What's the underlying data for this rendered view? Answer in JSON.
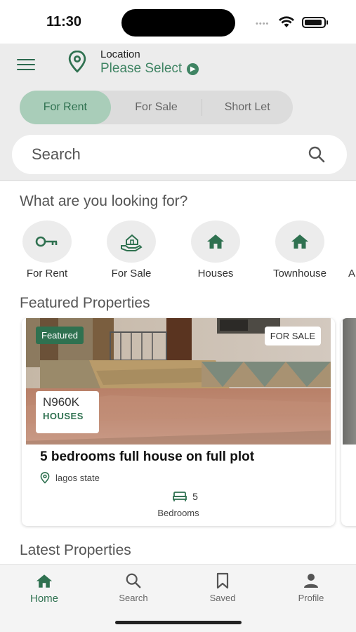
{
  "status_bar": {
    "time": "11:30"
  },
  "header": {
    "location_label": "Location",
    "location_value": "Please Select"
  },
  "segments": [
    {
      "label": "For Rent",
      "active": true
    },
    {
      "label": "For Sale",
      "active": false
    },
    {
      "label": "Short Let",
      "active": false
    }
  ],
  "search": {
    "placeholder": "Search",
    "value": ""
  },
  "categories": {
    "title": "What are you looking for?",
    "items": [
      {
        "label": "For Rent",
        "icon": "key-icon"
      },
      {
        "label": "For Sale",
        "icon": "house-hand-icon"
      },
      {
        "label": "Houses",
        "icon": "home-icon"
      },
      {
        "label": "Townhouse",
        "icon": "home-icon"
      },
      {
        "label": "A",
        "icon": "apartment-icon"
      }
    ]
  },
  "featured": {
    "title": "Featured Properties",
    "cards": [
      {
        "badge": "Featured",
        "status": "FOR SALE",
        "price": "N960K",
        "type": "HOUSES",
        "title": "5 bedrooms full house on full plot",
        "location": "lagos state",
        "bedrooms": "5",
        "bedrooms_label": "Bedrooms"
      }
    ]
  },
  "latest": {
    "title": "Latest Properties"
  },
  "bottom_nav": [
    {
      "label": "Home",
      "icon": "home-icon",
      "active": true
    },
    {
      "label": "Search",
      "icon": "search-icon",
      "active": false
    },
    {
      "label": "Saved",
      "icon": "bookmark-icon",
      "active": false
    },
    {
      "label": "Profile",
      "icon": "person-icon",
      "active": false
    }
  ],
  "colors": {
    "brand_green": "#2f7150",
    "accent_green": "#3f8463",
    "active_segment_bg": "#a9cdb9",
    "header_bg": "#ececec"
  }
}
